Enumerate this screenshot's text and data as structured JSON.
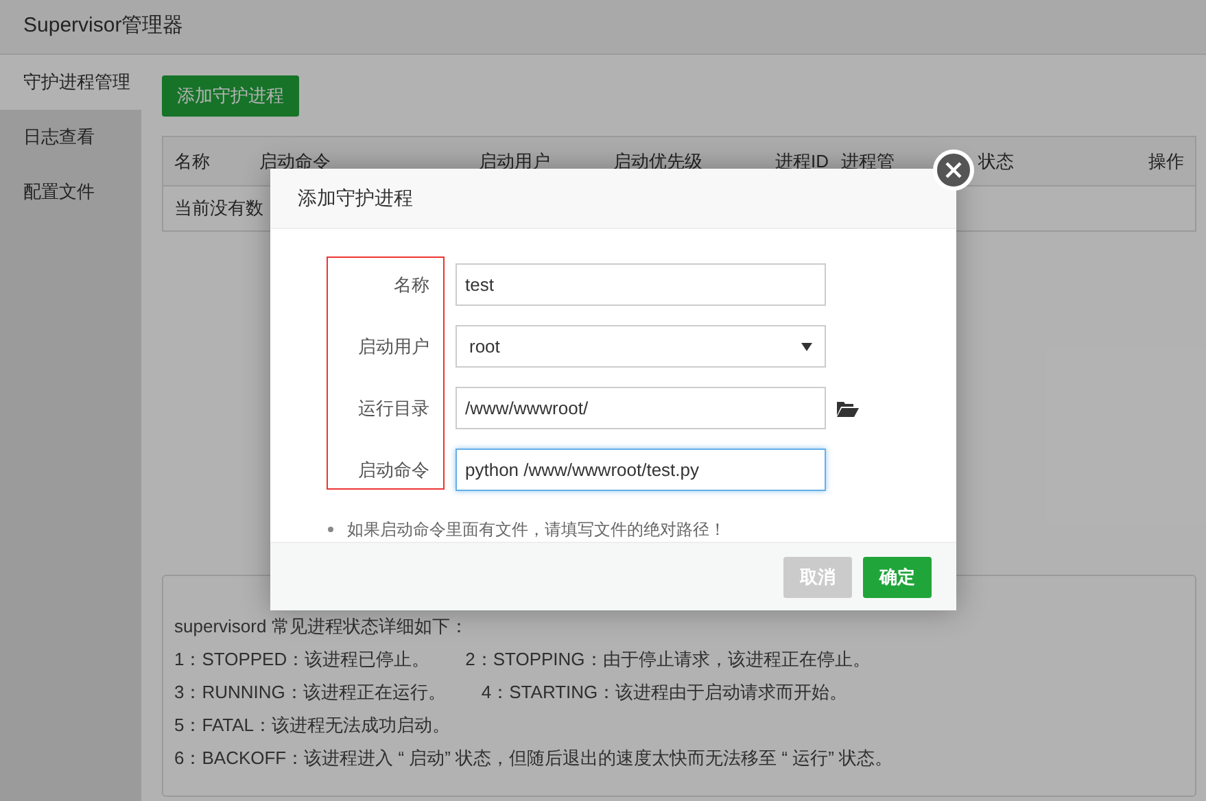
{
  "app": {
    "title": "Supervisor管理器"
  },
  "sidebar": {
    "items": [
      {
        "label": "守护进程管理",
        "selected": true
      },
      {
        "label": "日志查看",
        "selected": false
      },
      {
        "label": "配置文件",
        "selected": false
      }
    ]
  },
  "add_button": "添加守护进程",
  "table": {
    "columns": [
      "名称",
      "启动命令",
      "启动用户",
      "启动优先级",
      "进程ID",
      "进程管",
      "状态",
      "操作"
    ],
    "empty_text": "当前没有数"
  },
  "info": {
    "lines": [
      [
        "supervisord 常见进程状态详细如下："
      ],
      [
        "1：STOPPED：该进程已停止。",
        "2：STOPPING：由于停止请求，该进程正在停止。"
      ],
      [
        "3：RUNNING：该进程正在运行。",
        "4：STARTING：该进程由于启动请求而开始。"
      ],
      [
        "5：FATAL：该进程无法成功启动。"
      ],
      [
        "6：BACKOFF：该进程进入 “ 启动” 状态，但随后退出的速度太快而无法移至 “ 运行” 状态。"
      ]
    ]
  },
  "dialog": {
    "title": "添加守护进程",
    "fields": [
      {
        "kind": "text",
        "label": "名称",
        "value": "test",
        "focused": false
      },
      {
        "kind": "select",
        "label": "启动用户",
        "value": "root",
        "focused": false
      },
      {
        "kind": "path",
        "label": "运行目录",
        "value": "/www/wwwroot/",
        "focused": false
      },
      {
        "kind": "text",
        "label": "启动命令",
        "value": "python /www/wwwroot/test.py",
        "focused": true
      }
    ],
    "hint": "如果启动命令里面有文件，请填写文件的绝对路径！",
    "buttons": [
      {
        "kind": "cancel",
        "label": "取消"
      },
      {
        "kind": "confirm",
        "label": "确定"
      }
    ]
  }
}
